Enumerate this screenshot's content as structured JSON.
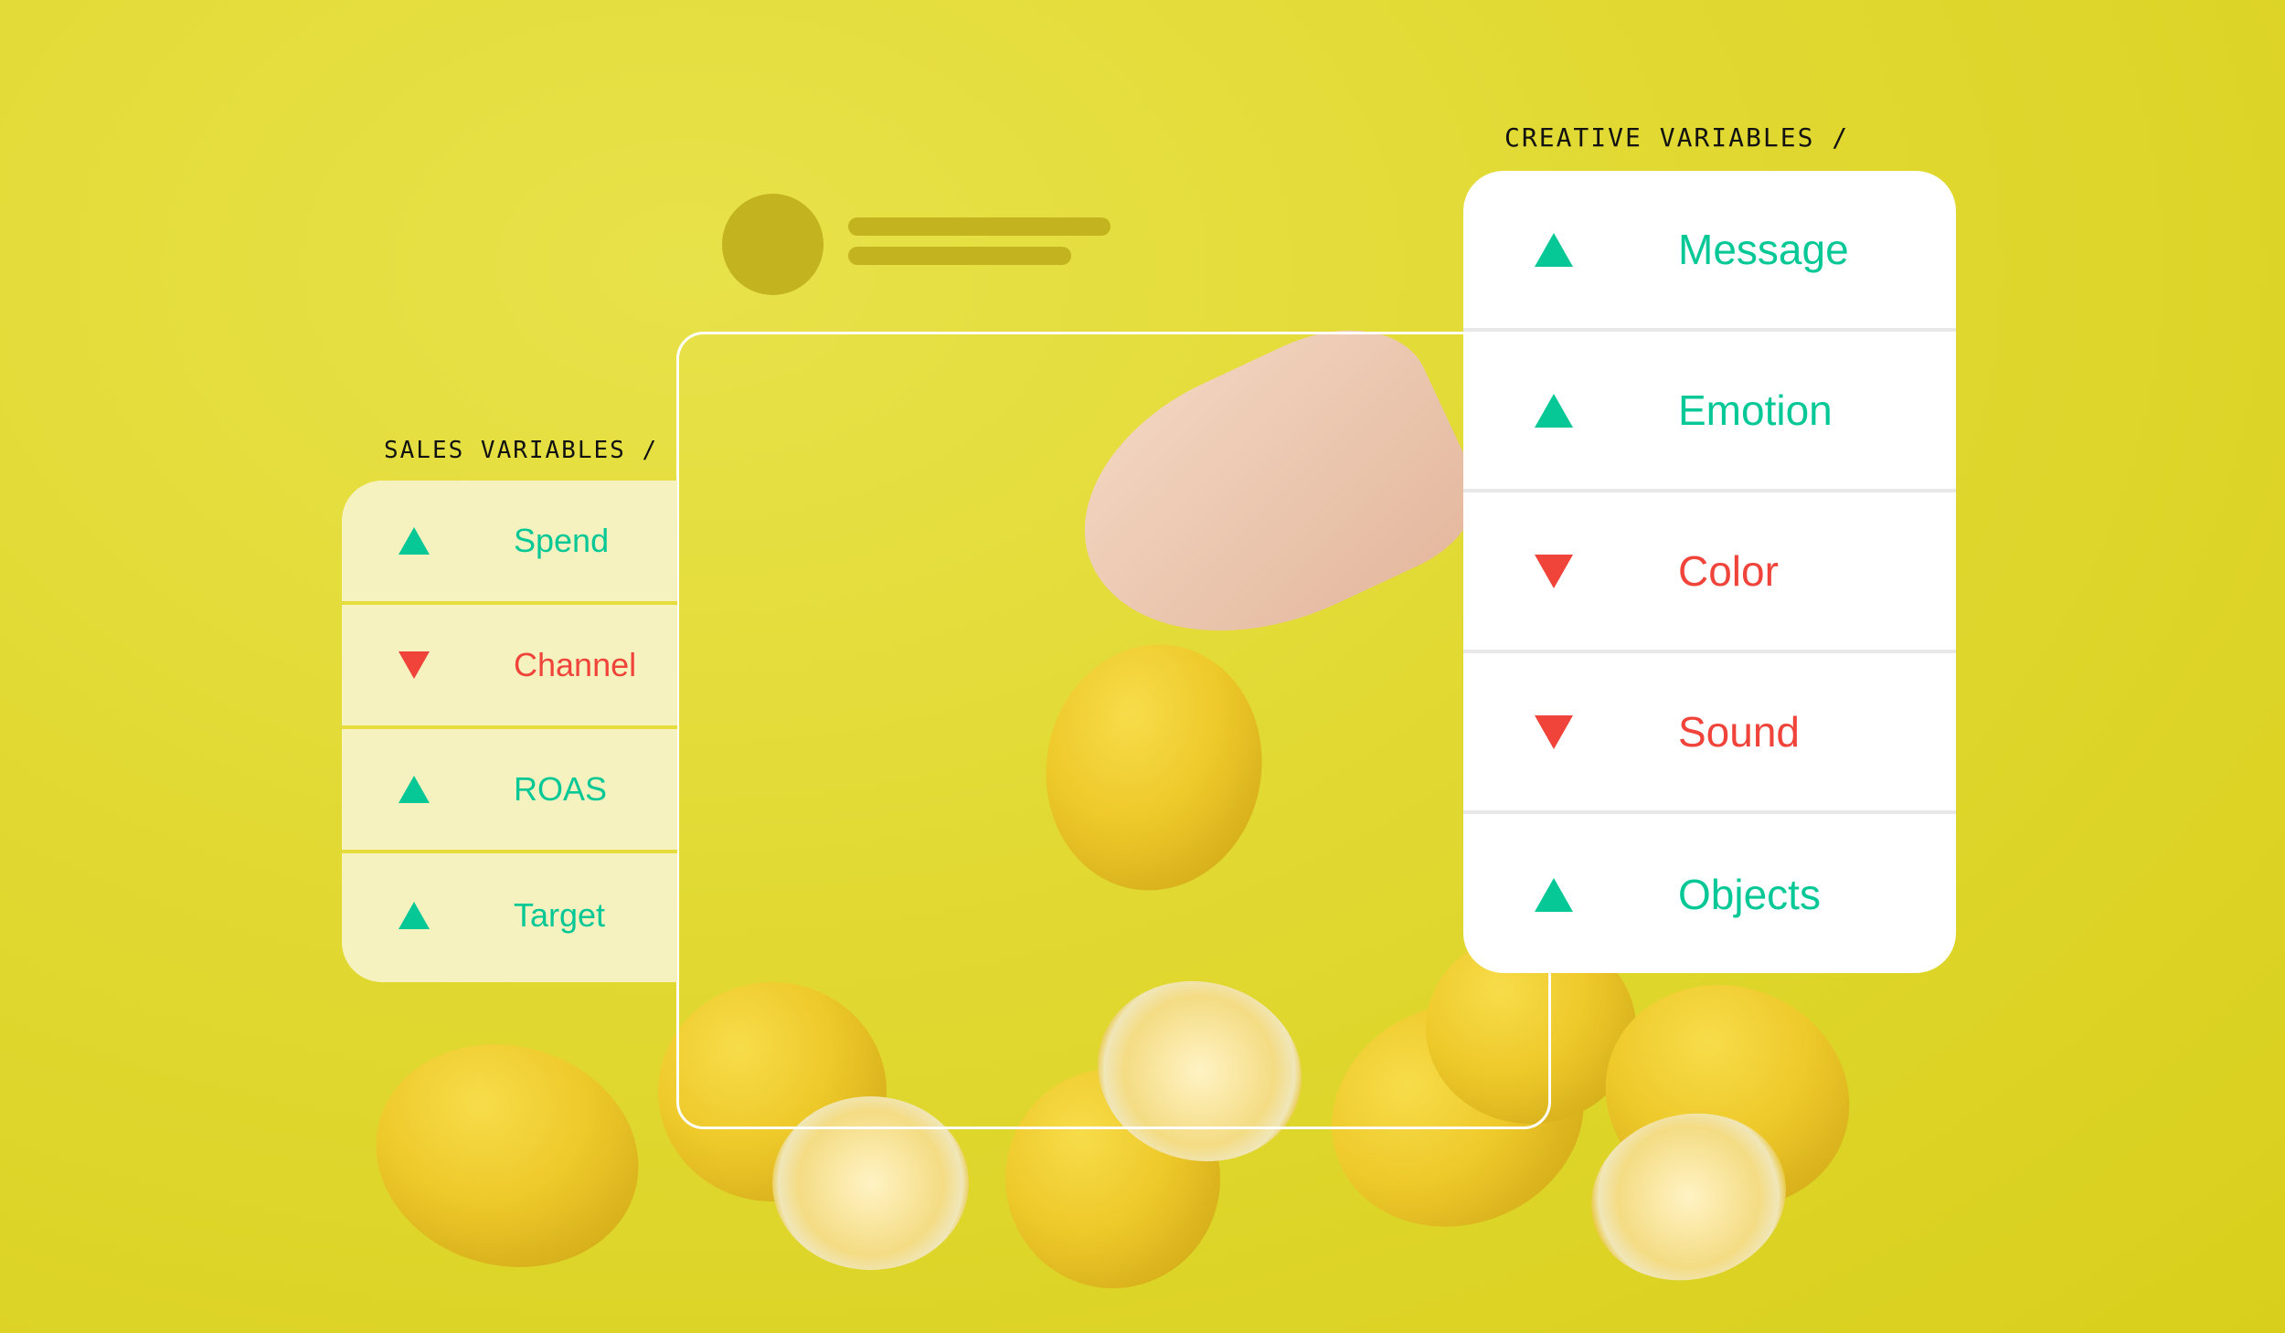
{
  "sales": {
    "title": "SALES VARIABLES /",
    "items": [
      {
        "label": "Spend",
        "trend": "up",
        "icon": "arrow-up-icon"
      },
      {
        "label": "Channel",
        "trend": "down",
        "icon": "arrow-down-icon"
      },
      {
        "label": "ROAS",
        "trend": "up",
        "icon": "arrow-up-icon"
      },
      {
        "label": "Target",
        "trend": "up",
        "icon": "arrow-up-icon"
      }
    ]
  },
  "creative": {
    "title": "CREATIVE VARIABLES /",
    "items": [
      {
        "label": "Message",
        "trend": "up",
        "icon": "arrow-up-icon"
      },
      {
        "label": "Emotion",
        "trend": "up",
        "icon": "arrow-up-icon"
      },
      {
        "label": "Color",
        "trend": "down",
        "icon": "arrow-down-icon"
      },
      {
        "label": "Sound",
        "trend": "down",
        "icon": "arrow-down-icon"
      },
      {
        "label": "Objects",
        "trend": "up",
        "icon": "arrow-up-icon"
      }
    ]
  },
  "colors": {
    "background": "#e2da34",
    "up": "#05c896",
    "down": "#f0433a",
    "placeholder": "#c3b31e"
  }
}
